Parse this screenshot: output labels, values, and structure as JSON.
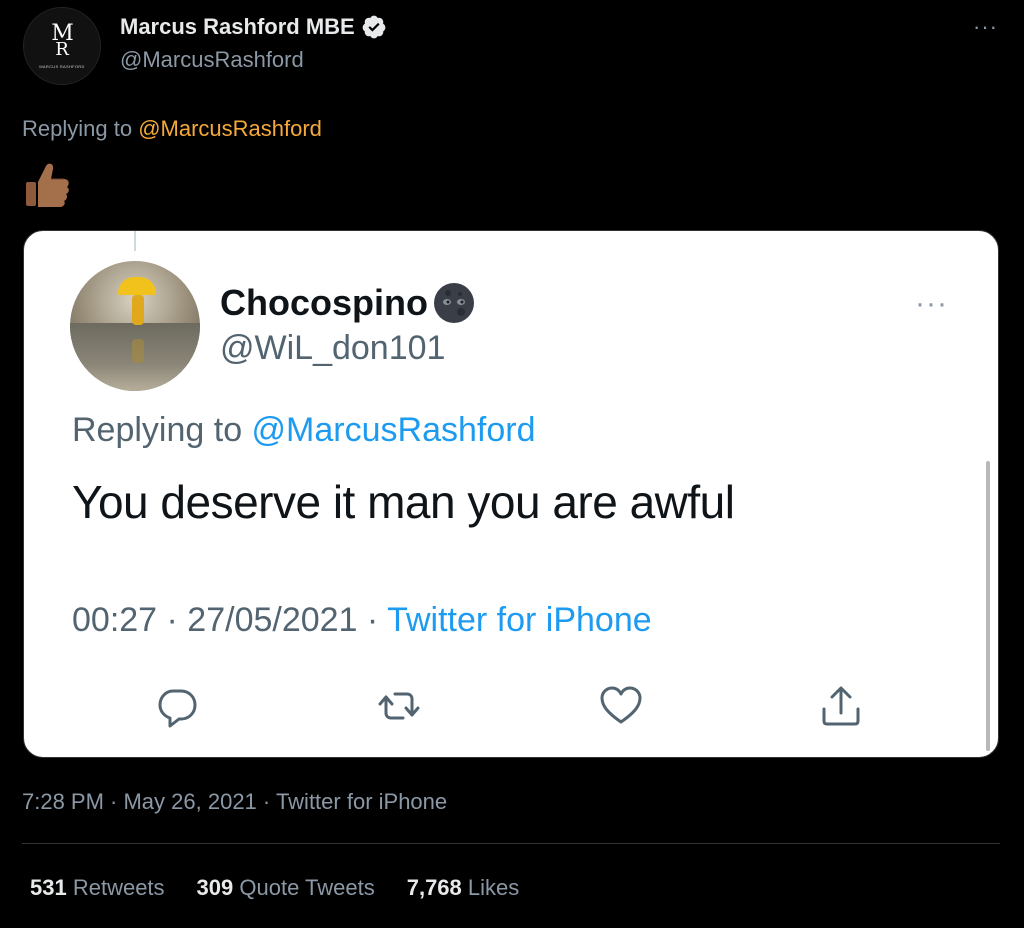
{
  "author": {
    "display_name": "Marcus Rashford MBE",
    "handle": "@MarcusRashford",
    "avatar_text": "MARCUS RASHFORD",
    "verified_icon": "verified-badge-icon"
  },
  "more_icon": "more-dots-icon",
  "reply_context": {
    "prefix": "Replying to ",
    "mention": "@MarcusRashford"
  },
  "tweet_body_icon": "thumbs-up-medium-skin-emoji",
  "embedded": {
    "display_name": "Chocospino",
    "name_icon": "new-moon-face-emoji",
    "handle": "@WiL_don101",
    "reply_prefix": "Replying to ",
    "reply_mention": "@MarcusRashford",
    "text": "You deserve it man you are awful",
    "time": "00:27 · 27/05/2021 · ",
    "source": "Twitter for iPhone",
    "actions": [
      "reply-icon",
      "retweet-icon",
      "like-icon",
      "share-icon"
    ]
  },
  "timestamp": "7:28 PM · May 26, 2021 · Twitter for iPhone",
  "stats": {
    "retweets_count": "531",
    "retweets_label": " Retweets",
    "quotes_count": "309",
    "quotes_label": " Quote Tweets",
    "likes_count": "7,768",
    "likes_label": " Likes"
  },
  "colors": {
    "background": "#000000",
    "mention_orange": "#f4a93a",
    "link_blue": "#1d9bf0",
    "muted_gray": "#8b98a5"
  }
}
